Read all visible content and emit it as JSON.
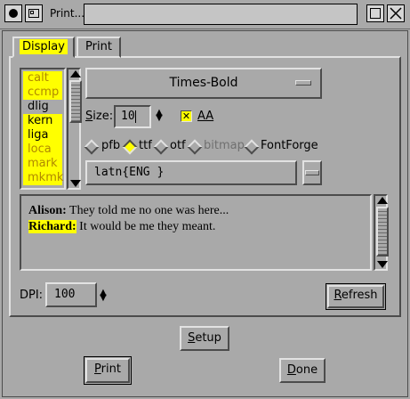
{
  "window": {
    "title": "Print...",
    "control_icons": [
      "menu-icon",
      "restore-icon"
    ],
    "right_icons": [
      "maximize-icon",
      "close-icon"
    ]
  },
  "tabs": [
    {
      "label": "Display",
      "selected": true
    },
    {
      "label": "Print",
      "selected": false
    }
  ],
  "features": [
    {
      "tag": "calt",
      "selected": true,
      "dim": true
    },
    {
      "tag": "ccmp",
      "selected": true,
      "dim": true
    },
    {
      "tag": "dlig",
      "selected": false,
      "dim": false
    },
    {
      "tag": "kern",
      "selected": true,
      "dim": false
    },
    {
      "tag": "liga",
      "selected": true,
      "dim": false
    },
    {
      "tag": "loca",
      "selected": true,
      "dim": true
    },
    {
      "tag": "mark",
      "selected": true,
      "dim": true
    },
    {
      "tag": "mkmk",
      "selected": true,
      "dim": true
    }
  ],
  "font": {
    "name": "Times-Bold"
  },
  "size": {
    "label": "Size:",
    "value": "10"
  },
  "antialias": {
    "label": "AA",
    "checked": true
  },
  "font_types": [
    {
      "label": "pfb",
      "selected": false,
      "enabled": true
    },
    {
      "label": "ttf",
      "selected": true,
      "enabled": true
    },
    {
      "label": "otf",
      "selected": false,
      "enabled": true
    },
    {
      "label": "bitmap",
      "selected": false,
      "enabled": false
    },
    {
      "label": "FontForge",
      "selected": false,
      "enabled": true
    }
  ],
  "script": {
    "value": "latn{ENG }"
  },
  "preview": {
    "lines": [
      {
        "speaker": "Alison:",
        "highlight": false,
        "text": " They told me no one was here..."
      },
      {
        "speaker": "Richard:",
        "highlight": true,
        "text": " It would be me they meant."
      }
    ]
  },
  "dpi": {
    "label": "DPI:",
    "value": "100"
  },
  "buttons": {
    "refresh": "Refresh",
    "setup": "Setup",
    "print": "Print",
    "done": "Done"
  },
  "colors": {
    "background": "#a9a9a9",
    "highlight": "#ffff00"
  }
}
